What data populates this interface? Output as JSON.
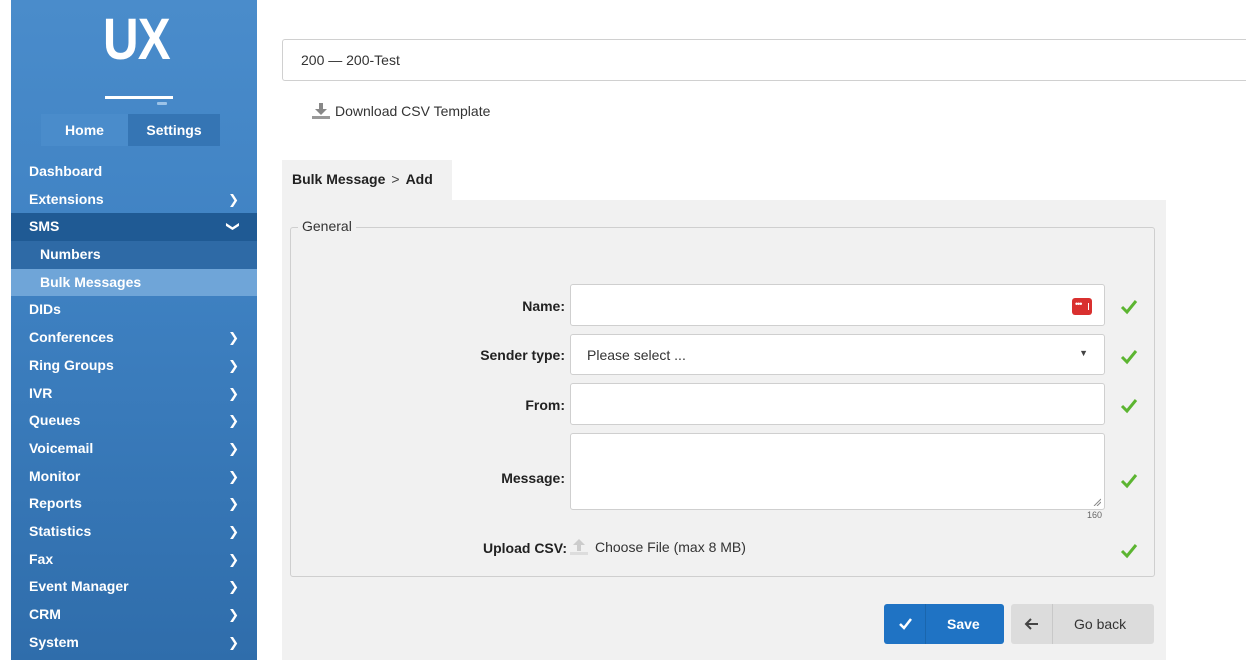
{
  "logo": {
    "text": "UX"
  },
  "tabs": [
    {
      "label": "Home"
    },
    {
      "label": "Settings"
    }
  ],
  "menu": [
    {
      "label": "Dashboard"
    },
    {
      "label": "Extensions"
    },
    {
      "label": "SMS"
    },
    {
      "label": "Numbers"
    },
    {
      "label": "Bulk Messages"
    },
    {
      "label": "DIDs"
    },
    {
      "label": "Conferences"
    },
    {
      "label": "Ring Groups"
    },
    {
      "label": "IVR"
    },
    {
      "label": "Queues"
    },
    {
      "label": "Voicemail"
    },
    {
      "label": "Monitor"
    },
    {
      "label": "Reports"
    },
    {
      "label": "Statistics"
    },
    {
      "label": "Fax"
    },
    {
      "label": "Event Manager"
    },
    {
      "label": "CRM"
    },
    {
      "label": "System"
    }
  ],
  "tenant": {
    "value": "200  —  200-Test"
  },
  "download": {
    "label": "Download CSV Template"
  },
  "breadcrumb": {
    "parent": "Bulk Message",
    "separator": ">",
    "current": "Add"
  },
  "form": {
    "legend": "General",
    "name_label": "Name:",
    "sender_label": "Sender type:",
    "sender_placeholder": "Please select ...",
    "from_label": "From:",
    "message_label": "Message:",
    "message_counter": "160",
    "upload_label": "Upload CSV:",
    "upload_text": "Choose File (max 8 MB)"
  },
  "buttons": {
    "save": "Save",
    "back": "Go back"
  },
  "colors": {
    "sidebar": "#3f82c3",
    "primary": "#1f73c4",
    "check": "#5cb531",
    "error": "#d9302f"
  }
}
